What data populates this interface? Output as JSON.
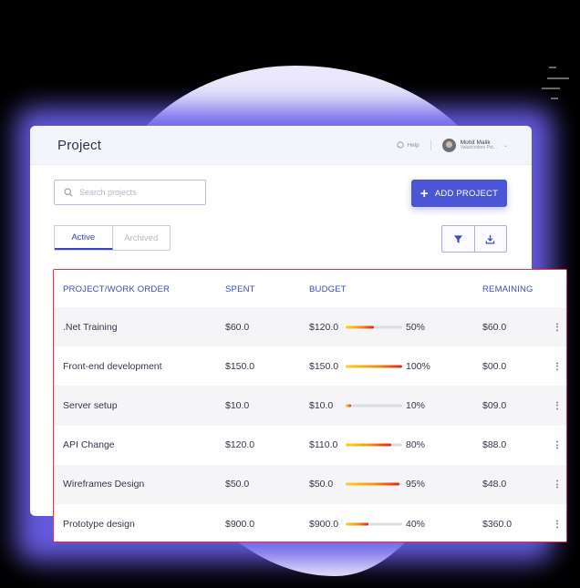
{
  "header": {
    "title": "Project",
    "help_label": "Help",
    "user_name": "Mohit Malik",
    "user_org": "Valuecoders Pvt..."
  },
  "search": {
    "placeholder": "Search projects",
    "value": ""
  },
  "toolbar": {
    "add_project_label": "ADD PROJECT"
  },
  "tabs": [
    {
      "label": "Active",
      "active": true
    },
    {
      "label": "Archived",
      "active": false
    }
  ],
  "table": {
    "columns": [
      "PROJECT/WORK ORDER",
      "SPENT",
      "BUDGET",
      "REMAINING"
    ],
    "rows": [
      {
        "name": ".Net Training",
        "spent": "$60.0",
        "budget": "$120.0",
        "percent_label": "50%",
        "progress": 50,
        "remaining": "$60.0"
      },
      {
        "name": "Front-end development",
        "spent": "$150.0",
        "budget": "$150.0",
        "percent_label": "100%",
        "progress": 100,
        "remaining": "$00.0"
      },
      {
        "name": "Server setup",
        "spent": "$10.0",
        "budget": "$10.0",
        "percent_label": "10%",
        "progress": 10,
        "remaining": "$09.0"
      },
      {
        "name": "API Change",
        "spent": "$120.0",
        "budget": "$110.0",
        "percent_label": "80%",
        "progress": 80,
        "remaining": "$88.0"
      },
      {
        "name": "Wireframes Design",
        "spent": "$50.0",
        "budget": "$50.0",
        "percent_label": "95%",
        "progress": 95,
        "remaining": "$48.0"
      },
      {
        "name": "Prototype design",
        "spent": "$900.0",
        "budget": "$900.0",
        "percent_label": "40%",
        "progress": 40,
        "remaining": "$360.0"
      }
    ]
  },
  "colors": {
    "accent": "#4a56d6",
    "table_header_text": "#3d49c7",
    "highlight_border": "#e2353f",
    "glow": "#6a5ee8"
  },
  "icons": [
    "help-icon",
    "search-icon",
    "plus-icon",
    "filter-icon",
    "download-icon",
    "more-vertical-icon"
  ]
}
